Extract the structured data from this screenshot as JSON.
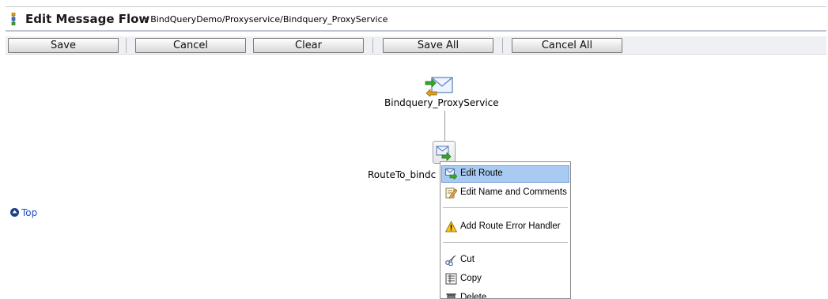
{
  "header": {
    "title": "Edit Message Flow",
    "path": " : BindQueryDemo/Proxyservice/Bindquery_ProxyService"
  },
  "toolbar": {
    "save": "Save",
    "cancel": "Cancel",
    "clear": "Clear",
    "save_all": "Save All",
    "cancel_all": "Cancel All"
  },
  "flow": {
    "proxy_label": "Bindquery_ProxyService",
    "route_label": "RouteTo_bindc"
  },
  "top_link": "Top",
  "context_menu": {
    "items": [
      {
        "label": "Edit Route",
        "icon": "edit-route-icon",
        "active": true
      },
      {
        "label": "Edit Name and Comments",
        "icon": "edit-name-icon"
      },
      {
        "label": "Add Route Error Handler",
        "icon": "warning-icon"
      },
      {
        "label": "Cut",
        "icon": "scissors-icon"
      },
      {
        "label": "Copy",
        "icon": "copy-icon"
      },
      {
        "label": "Delete",
        "icon": "trash-icon"
      }
    ]
  },
  "colors": {
    "accent": "#a9cbf2",
    "link": "#1d4fc7",
    "toolbar_bg": "#eef0f3"
  }
}
